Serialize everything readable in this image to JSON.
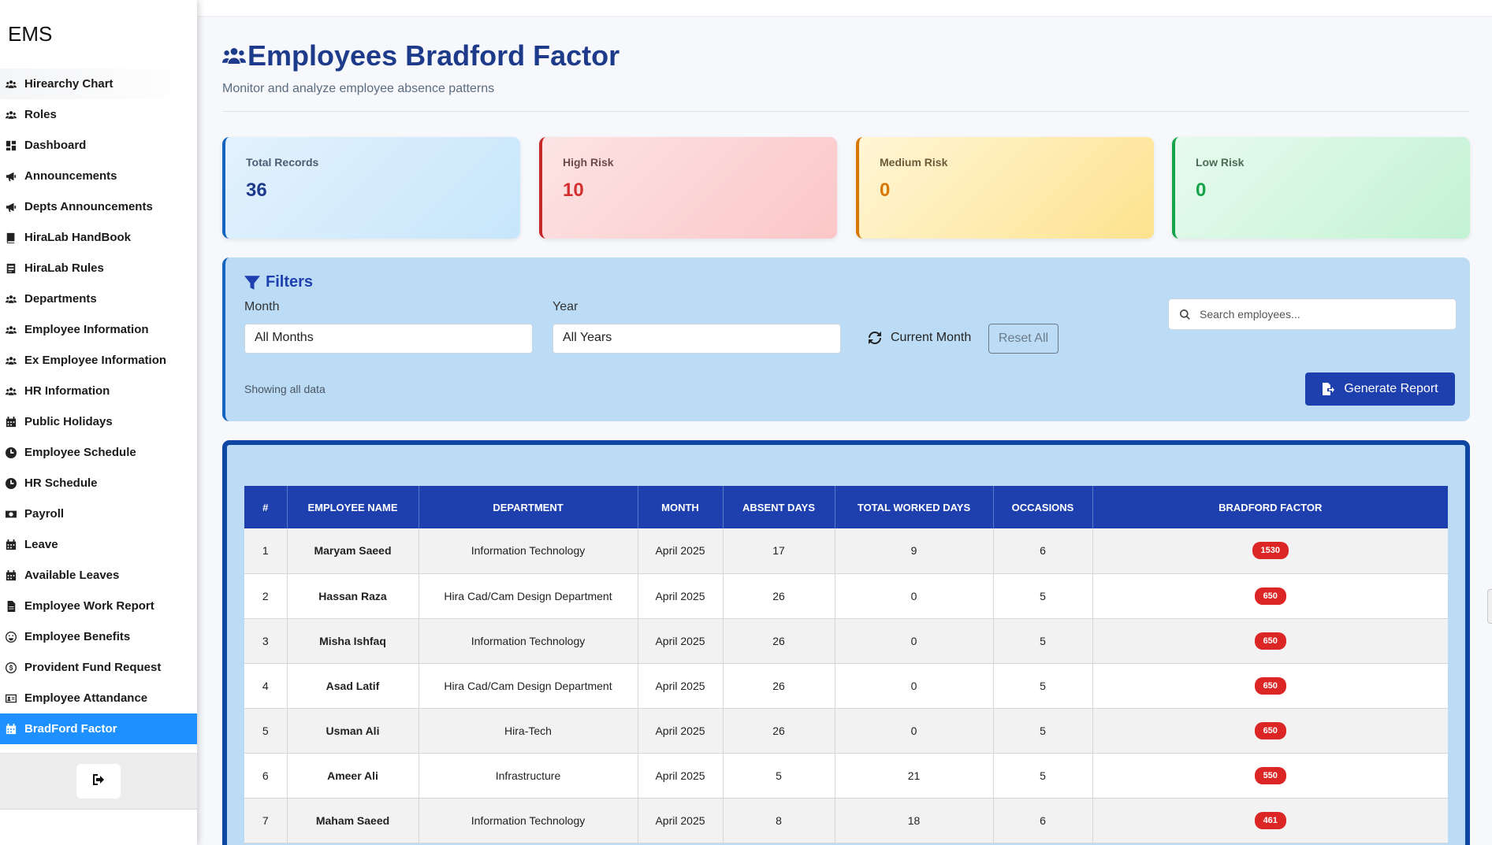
{
  "app": {
    "brand": "EMS"
  },
  "sidebar": {
    "items": [
      {
        "label": "Hirearchy Chart",
        "icon": "users-icon"
      },
      {
        "label": "Roles",
        "icon": "users-icon"
      },
      {
        "label": "Dashboard",
        "icon": "dashboard-icon"
      },
      {
        "label": "Announcements",
        "icon": "megaphone-icon"
      },
      {
        "label": "Depts Announcements",
        "icon": "megaphone-icon"
      },
      {
        "label": "HiraLab HandBook",
        "icon": "book-icon"
      },
      {
        "label": "HiraLab Rules",
        "icon": "rules-icon"
      },
      {
        "label": "Departments",
        "icon": "users-icon"
      },
      {
        "label": "Employee Information",
        "icon": "users-icon"
      },
      {
        "label": "Ex Employee Information",
        "icon": "users-icon"
      },
      {
        "label": "HR Information",
        "icon": "users-icon"
      },
      {
        "label": "Public Holidays",
        "icon": "calendar-icon"
      },
      {
        "label": "Employee Schedule",
        "icon": "clock-icon"
      },
      {
        "label": "HR Schedule",
        "icon": "clock-icon"
      },
      {
        "label": "Payroll",
        "icon": "money-icon"
      },
      {
        "label": "Leave",
        "icon": "calendar-icon"
      },
      {
        "label": "Available Leaves",
        "icon": "calendar-icon"
      },
      {
        "label": "Employee Work Report",
        "icon": "file-icon"
      },
      {
        "label": "Employee Benefits",
        "icon": "smile-icon"
      },
      {
        "label": "Provident Fund Request",
        "icon": "dollar-circle-icon"
      },
      {
        "label": "Employee Attandance",
        "icon": "id-card-icon"
      },
      {
        "label": "BradFord Factor",
        "icon": "calendar-icon",
        "active": true
      }
    ],
    "logout_icon": "sign-out-icon"
  },
  "header": {
    "title": "Employees Bradford Factor",
    "subtitle": "Monitor and analyze employee absence patterns"
  },
  "stats": {
    "total": {
      "label": "Total Records",
      "value": "36"
    },
    "high": {
      "label": "High Risk",
      "value": "10"
    },
    "medium": {
      "label": "Medium Risk",
      "value": "0"
    },
    "low": {
      "label": "Low Risk",
      "value": "0"
    }
  },
  "filters": {
    "title": "Filters",
    "month_label": "Month",
    "month_value": "All Months",
    "year_label": "Year",
    "year_value": "All Years",
    "current_month": "Current Month",
    "reset": "Reset All",
    "search_placeholder": "Search employees...",
    "showing": "Showing all data",
    "generate": "Generate Report"
  },
  "table": {
    "columns": [
      "#",
      "EMPLOYEE NAME",
      "DEPARTMENT",
      "MONTH",
      "ABSENT DAYS",
      "TOTAL WORKED DAYS",
      "OCCASIONS",
      "BRADFORD FACTOR"
    ],
    "rows": [
      {
        "num": "1",
        "name": "Maryam Saeed",
        "dept": "Information Technology",
        "month": "April 2025",
        "absent": "17",
        "worked": "9",
        "occasions": "6",
        "bradford": "1530"
      },
      {
        "num": "2",
        "name": "Hassan Raza",
        "dept": "Hira Cad/Cam Design Department",
        "month": "April 2025",
        "absent": "26",
        "worked": "0",
        "occasions": "5",
        "bradford": "650"
      },
      {
        "num": "3",
        "name": "Misha Ishfaq",
        "dept": "Information Technology",
        "month": "April 2025",
        "absent": "26",
        "worked": "0",
        "occasions": "5",
        "bradford": "650"
      },
      {
        "num": "4",
        "name": "Asad Latif",
        "dept": "Hira Cad/Cam Design Department",
        "month": "April 2025",
        "absent": "26",
        "worked": "0",
        "occasions": "5",
        "bradford": "650"
      },
      {
        "num": "5",
        "name": "Usman Ali",
        "dept": "Hira-Tech",
        "month": "April 2025",
        "absent": "26",
        "worked": "0",
        "occasions": "5",
        "bradford": "650"
      },
      {
        "num": "6",
        "name": "Ameer Ali",
        "dept": "Infrastructure",
        "month": "April 2025",
        "absent": "5",
        "worked": "21",
        "occasions": "5",
        "bradford": "550"
      },
      {
        "num": "7",
        "name": "Maham Saeed",
        "dept": "Information Technology",
        "month": "April 2025",
        "absent": "8",
        "worked": "18",
        "occasions": "6",
        "bradford": "461"
      }
    ]
  },
  "colors": {
    "accent": "#1e40af",
    "active_nav": "#1e90ff",
    "high_risk": "#dc2626",
    "medium_risk": "#d97706",
    "low_risk": "#16a34a"
  }
}
